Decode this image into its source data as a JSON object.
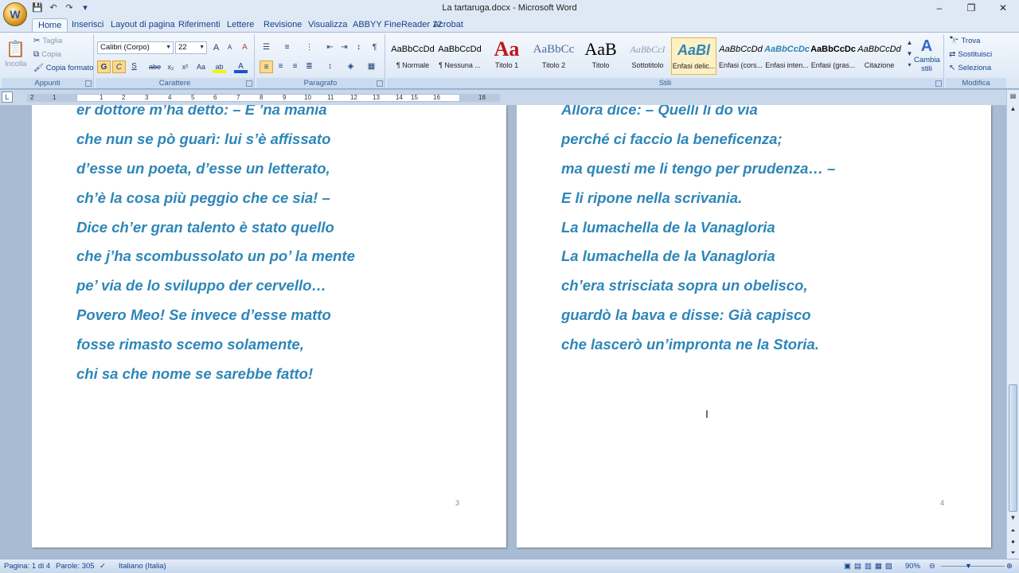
{
  "window": {
    "title": "La tartaruga.docx - Microsoft Word",
    "controls": [
      "–",
      "❐",
      "✕"
    ]
  },
  "qat": [
    "💾",
    "↶",
    "↷",
    "▾"
  ],
  "tabs": [
    "Home",
    "Inserisci",
    "Layout di pagina",
    "Riferimenti",
    "Lettere",
    "Revisione",
    "Visualizza",
    "ABBYY FineReader 12",
    "Acrobat"
  ],
  "ribbon": {
    "clipboard": {
      "label": "Appunti",
      "paste": "Incolla",
      "cut": "Taglia",
      "copy": "Copia",
      "format_painter": "Copia formato"
    },
    "font": {
      "label": "Carattere",
      "font_name": "Calibri (Corpo)",
      "font_size": "22",
      "grow": "A",
      "shrink": "A",
      "clear": "A",
      "bold": "G",
      "italic": "C",
      "underline": "S",
      "strike": "abe",
      "sub": "x₂",
      "sup": "x²",
      "case": "Aa",
      "highlight": "ab",
      "color": "A"
    },
    "paragraph": {
      "label": "Paragrafo"
    },
    "styles": {
      "label": "Stili",
      "items": [
        {
          "preview": "AaBbCcDd",
          "name": "¶ Normale"
        },
        {
          "preview": "AaBbCcDd",
          "name": "¶ Nessuna ..."
        },
        {
          "preview": "Aa",
          "name": "Titolo 1"
        },
        {
          "preview": "AaBbCc",
          "name": "Titolo 2"
        },
        {
          "preview": "AaB",
          "name": "Titolo"
        },
        {
          "preview": "AaBbCcI",
          "name": "Sottotitolo"
        },
        {
          "preview": "AaBl",
          "name": "Enfasi delic..."
        },
        {
          "preview": "AaBbCcDd",
          "name": "Enfasi (cors..."
        },
        {
          "preview": "AaBbCcDc",
          "name": "Enfasi inten..."
        },
        {
          "preview": "AaBbCcDc",
          "name": "Enfasi (gras..."
        },
        {
          "preview": "AaBbCcDd",
          "name": "Citazione"
        }
      ],
      "change_styles": "Cambia stili"
    },
    "editing": {
      "label": "Modifica",
      "find": "Trova",
      "replace": "Sostituisci",
      "select": "Seleziona"
    }
  },
  "ruler": {
    "numbers": [
      "2",
      "1",
      "1",
      "2",
      "3",
      "4",
      "5",
      "6",
      "7",
      "8",
      "9",
      "10",
      "11",
      "12",
      "13",
      "14",
      "15",
      "16",
      "18"
    ]
  },
  "pages": [
    {
      "number": "3",
      "lines": [
        "er dottore m’ha detto: – E ’na mania",
        "che nun se pò guarì: lui s’è affissato",
        "d’esse un poeta, d’esse un letterato,",
        "ch’è la cosa più peggio che ce sia! –",
        "Dice ch’er gran talento è stato quello",
        "che j’ha scombussolato un po’ la mente",
        "pe’ via de lo sviluppo der cervello…",
        "Povero Meo! Se invece d’esse matto",
        "fosse rimasto scemo solamente,",
        "chi sa che nome se sarebbe fatto!"
      ]
    },
    {
      "number": "4",
      "lines": [
        "Allora dice: – Quelli li do via",
        "perché ci faccio la beneficenza;",
        "ma questi me li tengo per prudenza… –",
        "E li ripone nella scrivania.",
        "La lumachella de la Vanagloria",
        "La lumachella de la Vanagloria",
        "ch’era strisciata sopra un obelisco,",
        "guardò la bava e disse: Già capisco",
        "che lascerò un’impronta ne la Storia."
      ]
    }
  ],
  "status": {
    "page": "Pagina: 1 di 4",
    "words": "Parole: 305",
    "language": "Italiano (Italia)",
    "zoom": "90%"
  },
  "colors": {
    "poem_text": "#2e86b8",
    "accent": "#15428b"
  }
}
